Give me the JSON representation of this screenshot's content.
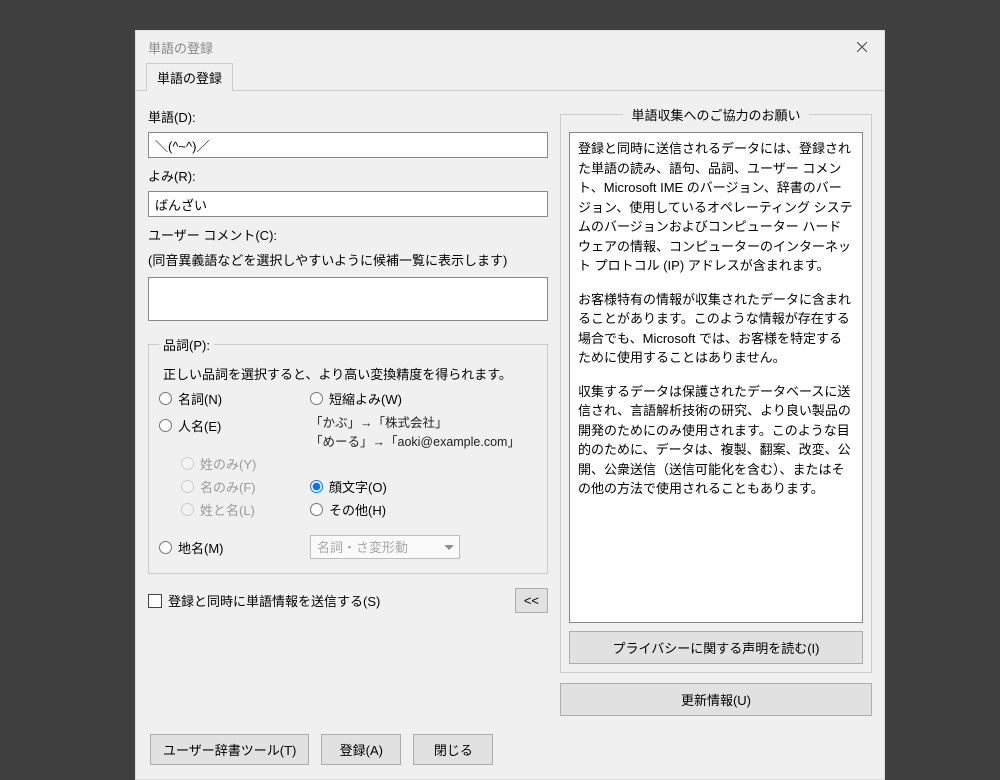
{
  "window": {
    "title": "単語の登録"
  },
  "tab": {
    "label": "単語の登録"
  },
  "fields": {
    "word_label": "単語(D):",
    "word_value": "＼(^~^)／",
    "reading_label": "よみ(R):",
    "reading_value": "ばんざい",
    "comment_label": "ユーザー コメント(C):",
    "comment_hint": "(同音異義語などを選択しやすいように候補一覧に表示します)",
    "comment_value": ""
  },
  "pos": {
    "legend": "品詞(P):",
    "instruction": "正しい品詞を選択すると、より高い変換精度を得られます。",
    "options": {
      "noun": "名詞(N)",
      "short": "短縮よみ(W)",
      "person": "人名(E)",
      "surname_only": "姓のみ(Y)",
      "given_only": "名のみ(F)",
      "both_names": "姓と名(L)",
      "kaomoji": "顔文字(O)",
      "other": "その他(H)",
      "place": "地名(M)"
    },
    "examples": {
      "ex1": "「かぶ」→「株式会社」",
      "ex2": "「めーる」→「aoki@example.com」"
    },
    "subtype_placeholder": "名詞・さ変形動",
    "selected": "kaomoji"
  },
  "send": {
    "label": "登録と同時に単語情報を送信する(S)",
    "collapse_button": "<<"
  },
  "consent": {
    "legend": "単語収集へのご協力のお願い",
    "para1": "登録と同時に送信されるデータには、登録された単語の読み、語句、品詞、ユーザー コメント、Microsoft IME のバージョン、辞書のバージョン、使用しているオペレーティング システムのバージョンおよびコンピューター ハードウェアの情報、コンピューターのインターネット プロトコル (IP) アドレスが含まれます。",
    "para2": "お客様特有の情報が収集されたデータに含まれることがあります。このような情報が存在する場合でも、Microsoft では、お客様を特定するために使用することはありません。",
    "para3": "収集するデータは保護されたデータベースに送信され、言語解析技術の研究、より良い製品の開発のためにのみ使用されます。このような目的のために、データは、複製、翻案、改変、公開、公衆送信（送信可能化を含む）、またはその他の方法で使用されることもあります。",
    "privacy_button": "プライバシーに関する声明を読む(I)",
    "update_button": "更新情報(U)"
  },
  "footer": {
    "dict_tool": "ユーザー辞書ツール(T)",
    "register": "登録(A)",
    "close": "閉じる"
  }
}
